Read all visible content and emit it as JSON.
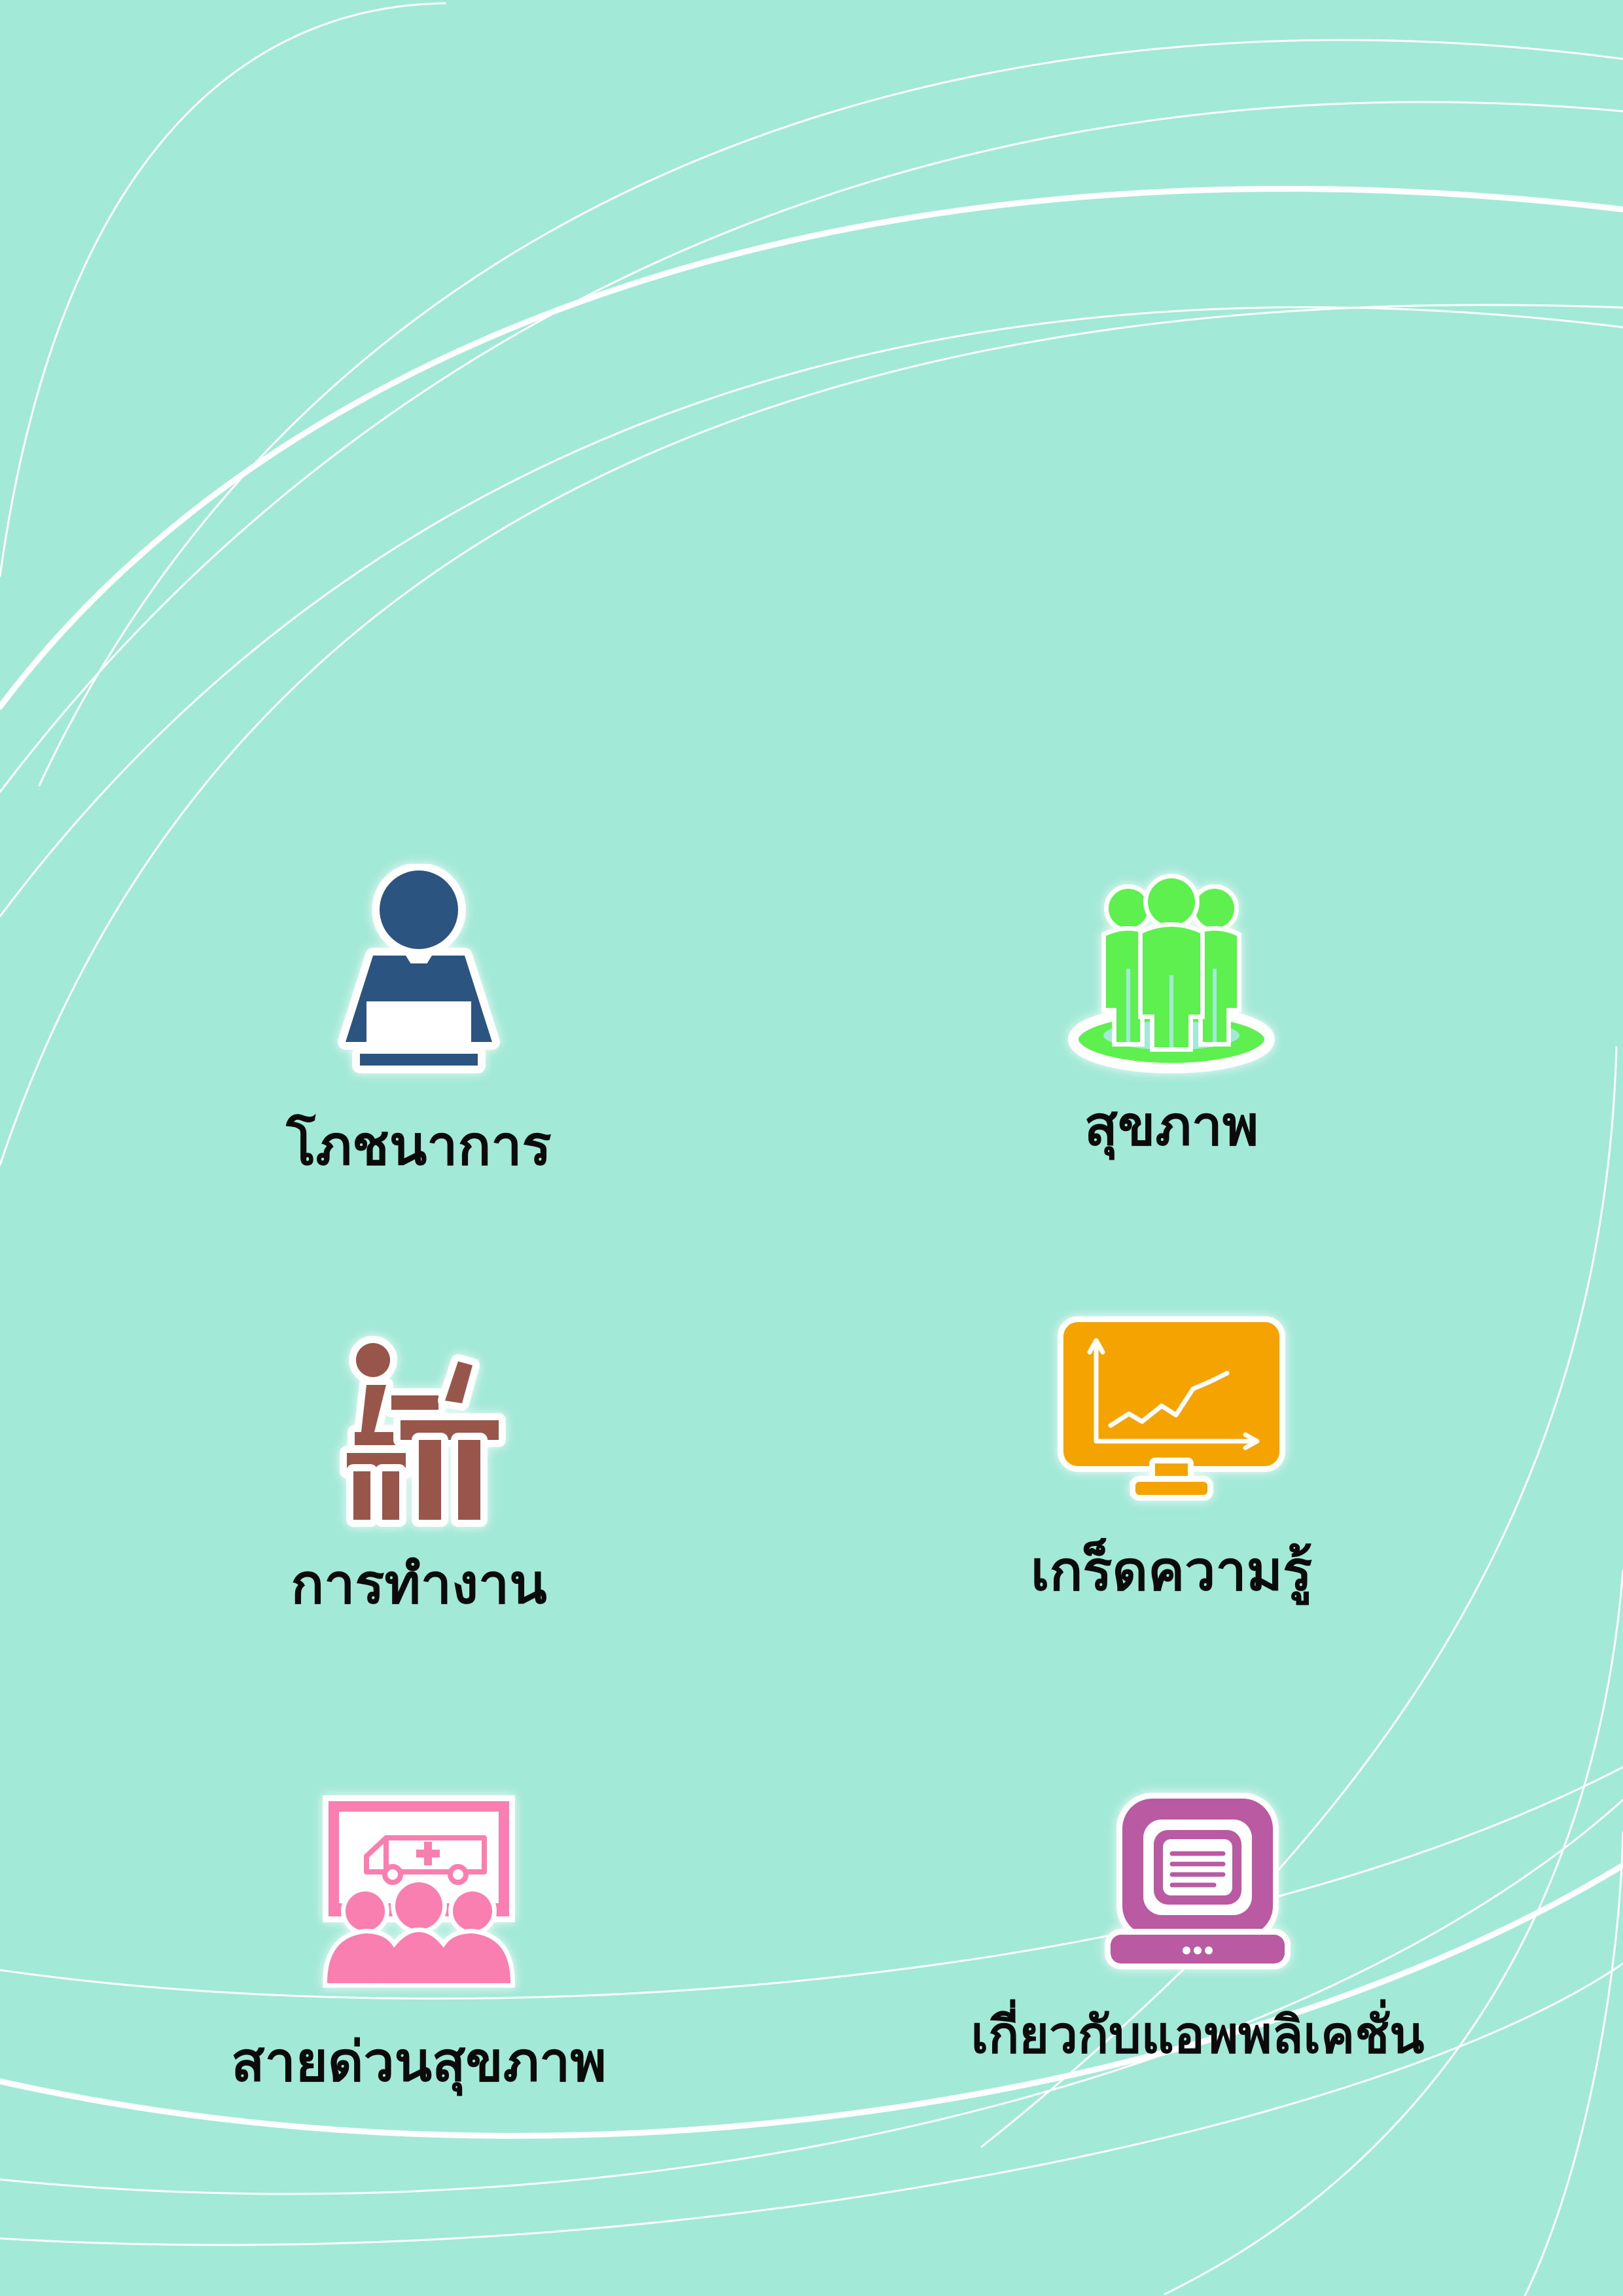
{
  "menu": {
    "items": [
      {
        "id": "nutrition",
        "label": "โภชนาการ",
        "icon": "person-laptop-icon",
        "color": "#2b5580"
      },
      {
        "id": "health",
        "label": "สุขภาพ",
        "icon": "group-people-icon",
        "color": "#5ef04f"
      },
      {
        "id": "work",
        "label": "การทำงาน",
        "icon": "person-at-desk-icon",
        "color": "#98554a"
      },
      {
        "id": "knowledge",
        "label": "เกร็ดความรู้",
        "icon": "monitor-chart-icon",
        "color": "#f5a300"
      },
      {
        "id": "hotline",
        "label": "สายด่วนสุขภาพ",
        "icon": "ambulance-crowd-icon",
        "color": "#f87fb0"
      },
      {
        "id": "about",
        "label": "เกี่ยวกับแอพพลิเคชั่น",
        "icon": "computer-icon",
        "color": "#b95aa3"
      }
    ]
  },
  "theme": {
    "background": "#a3e9d7",
    "lines": "#ffffff"
  }
}
